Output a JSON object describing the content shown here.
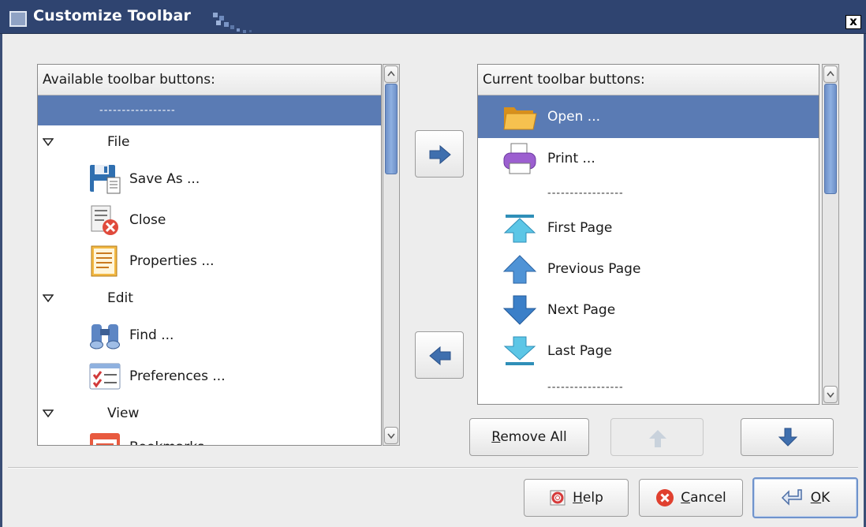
{
  "window": {
    "title": "Customize Toolbar",
    "close_glyph": "x"
  },
  "available": {
    "header": "Available toolbar buttons:",
    "items": [
      {
        "type": "separator",
        "label": "-----------------"
      },
      {
        "type": "group",
        "label": "File"
      },
      {
        "type": "item",
        "label": "Save As ...",
        "icon": "save-as-icon"
      },
      {
        "type": "item",
        "label": "Close",
        "icon": "close-document-icon"
      },
      {
        "type": "item",
        "label": "Properties ...",
        "icon": "properties-icon"
      },
      {
        "type": "group",
        "label": "Edit"
      },
      {
        "type": "item",
        "label": "Find ...",
        "icon": "binoculars-icon"
      },
      {
        "type": "item",
        "label": "Preferences ...",
        "icon": "preferences-icon"
      },
      {
        "type": "group",
        "label": "View"
      },
      {
        "type": "item",
        "label": "Bookmarks",
        "icon": "bookmarks-icon"
      }
    ]
  },
  "current": {
    "header": "Current toolbar buttons:",
    "items": [
      {
        "type": "item",
        "label": "Open ...",
        "icon": "folder-icon"
      },
      {
        "type": "item",
        "label": "Print ...",
        "icon": "printer-icon"
      },
      {
        "type": "separator",
        "label": "-----------------"
      },
      {
        "type": "item",
        "label": "First Page",
        "icon": "first-page-icon"
      },
      {
        "type": "item",
        "label": "Previous Page",
        "icon": "previous-page-icon"
      },
      {
        "type": "item",
        "label": "Next Page",
        "icon": "next-page-icon"
      },
      {
        "type": "item",
        "label": "Last Page",
        "icon": "last-page-icon"
      },
      {
        "type": "separator",
        "label": "-----------------"
      }
    ]
  },
  "buttons": {
    "remove_all": {
      "mnemonic": "R",
      "rest": "emove All"
    },
    "help": {
      "mnemonic": "H",
      "rest": "elp"
    },
    "cancel": {
      "mnemonic": "C",
      "rest": "ancel"
    },
    "ok": {
      "mnemonic": "O",
      "rest": "K"
    }
  },
  "colors": {
    "selection": "#5a7bb4",
    "titlebar": "#2f4470",
    "arrow": "#3f6fae"
  }
}
